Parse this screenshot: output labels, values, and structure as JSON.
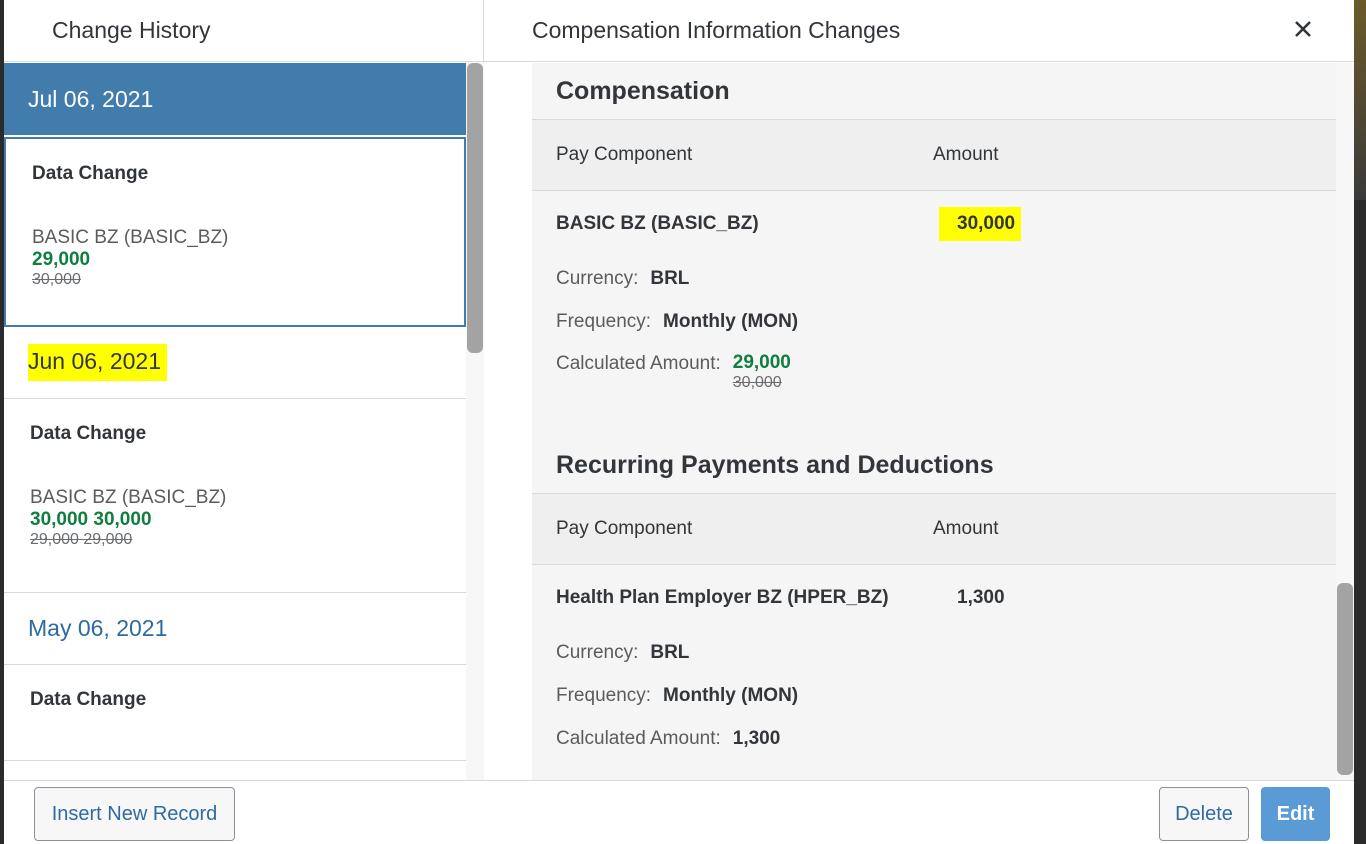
{
  "left": {
    "title": "Change History",
    "entries": [
      {
        "date": "Jul 06, 2021",
        "change_title": "Data Change",
        "component": "BASIC BZ (BASIC_BZ)",
        "new_value": "29,000",
        "old_value": "30,000"
      },
      {
        "date": "Jun 06, 2021",
        "change_title": "Data Change",
        "component": "BASIC BZ (BASIC_BZ)",
        "new_value": "30,000 30,000",
        "old_value": "29,000 29,000"
      },
      {
        "date": "May 06, 2021",
        "change_title": "Data Change"
      }
    ],
    "insert_button": "Insert New Record"
  },
  "right": {
    "title": "Compensation Information Changes",
    "compensation": {
      "section_title": "Compensation",
      "col_pay_component": "Pay Component",
      "col_amount": "Amount",
      "row": {
        "name": "BASIC BZ (BASIC_BZ)",
        "amount": "30,000",
        "currency_label": "Currency:",
        "currency_value": "BRL",
        "frequency_label": "Frequency:",
        "frequency_value": "Monthly (MON)",
        "calc_label": "Calculated Amount:",
        "calc_new": "29,000",
        "calc_old": "30,000"
      }
    },
    "recurring": {
      "section_title": "Recurring Payments and Deductions",
      "col_pay_component": "Pay Component",
      "col_amount": "Amount",
      "row": {
        "name": "Health Plan Employer BZ (HPER_BZ)",
        "amount": "1,300",
        "currency_label": "Currency:",
        "currency_value": "BRL",
        "frequency_label": "Frequency:",
        "frequency_value": "Monthly (MON)",
        "calc_label": "Calculated Amount:",
        "calc_value": "1,300"
      }
    },
    "delete_button": "Delete",
    "edit_button": "Edit"
  },
  "colors": {
    "selected_date_bg": "#427cac",
    "new_value": "#107e3e",
    "highlight": "#ffff00",
    "edit_button": "#5a9bd5"
  },
  "icons": {
    "close": "close-icon"
  }
}
